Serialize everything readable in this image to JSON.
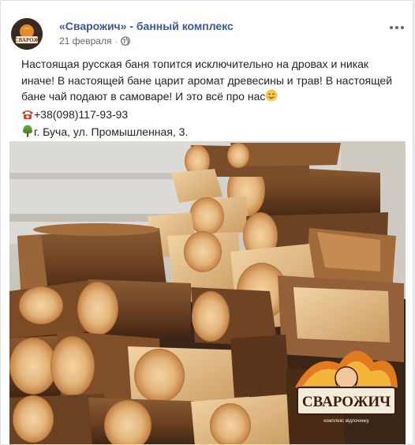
{
  "post": {
    "page_name": "«Сварожич» - банный комплекс",
    "date": "21 февраля",
    "separator": "·",
    "text_line1": "Настоящая русская баня топится исключительно на дровах и никак иначе! В настоящей бане царит аромат древесины и трав! В настоящей бане чай подают в самоваре! И это всё про нас",
    "phone": "+38(098)117-93-93",
    "address": "г. Буча, ул. Промышленная, 3."
  },
  "photo": {
    "logo_text": "СВАРОЖИЧ",
    "logo_subtext": "комплекс відпочинку"
  },
  "icons": {
    "audience": "globe-icon",
    "menu": "more-dots-icon",
    "smile": "smile-emoji-icon",
    "phone": "telephone-emoji-icon",
    "location": "tree-emoji-icon"
  }
}
